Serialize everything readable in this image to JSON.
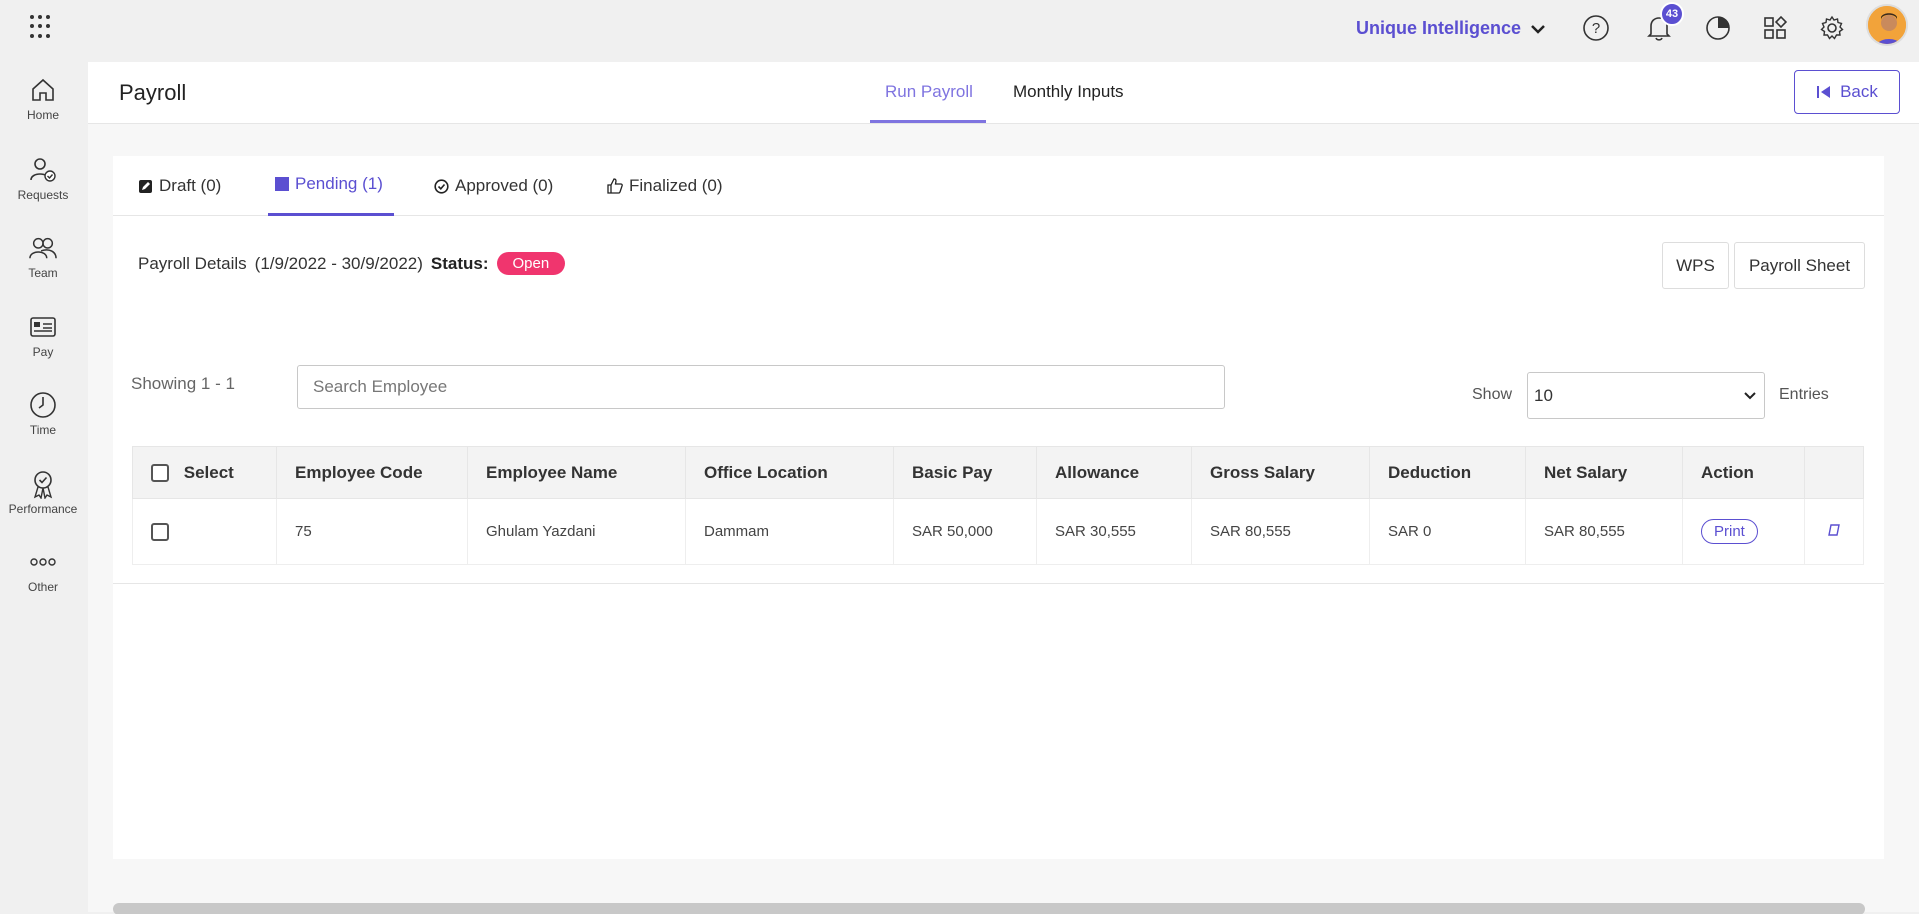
{
  "topbar": {
    "company": "Unique Intelligence",
    "notification_count": "43"
  },
  "sidebar": {
    "items": [
      {
        "label": "Home",
        "icon": "home-icon"
      },
      {
        "label": "Requests",
        "icon": "requests-icon"
      },
      {
        "label": "Team",
        "icon": "team-icon"
      },
      {
        "label": "Pay",
        "icon": "pay-icon"
      },
      {
        "label": "Time",
        "icon": "clock-icon"
      },
      {
        "label": "Performance",
        "icon": "award-icon"
      },
      {
        "label": "Other",
        "icon": "more-icon"
      }
    ]
  },
  "header": {
    "title": "Payroll",
    "tabs": [
      "Run Payroll",
      "Monthly Inputs"
    ],
    "active_tab": "Run Payroll",
    "back_label": "Back"
  },
  "status_tabs": [
    {
      "label": "Draft (0)"
    },
    {
      "label": "Pending (1)"
    },
    {
      "label": "Approved (0)"
    },
    {
      "label": "Finalized (0)"
    }
  ],
  "details": {
    "label": "Payroll Details",
    "period": "(1/9/2022 - 30/9/2022)",
    "status_label": "Status:",
    "status_value": "Open",
    "status_color": "#f0356e"
  },
  "actions": {
    "wps": "WPS",
    "payroll_sheet": "Payroll Sheet"
  },
  "list": {
    "showing": "Showing 1 - 1",
    "search_placeholder": "Search Employee",
    "show_label": "Show",
    "entries_value": "10",
    "entries_label": "Entries"
  },
  "table": {
    "headers": [
      "Select",
      "Employee Code",
      "Employee Name",
      "Office Location",
      "Basic Pay",
      "Allowance",
      "Gross Salary",
      "Deduction",
      "Net Salary",
      "Action"
    ],
    "rows": [
      {
        "employee_code": "75",
        "employee_name": "Ghulam Yazdani",
        "office_location": "Dammam",
        "basic_pay": "SAR 50,000",
        "allowance": "SAR 30,555",
        "gross_salary": "SAR 80,555",
        "deduction": "SAR 0",
        "net_salary": "SAR 80,555",
        "action": "Print"
      }
    ]
  },
  "colors": {
    "accent": "#5b4fd1",
    "accent_light": "#7f74e0"
  }
}
